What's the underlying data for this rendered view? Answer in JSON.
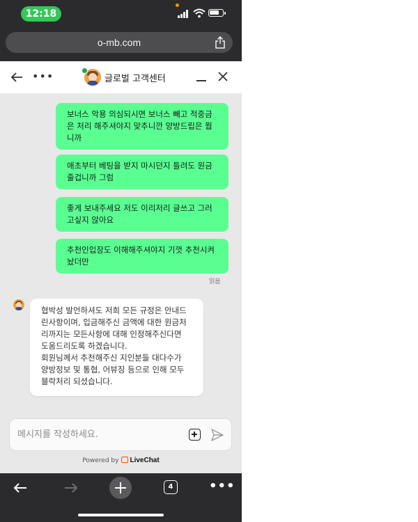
{
  "status_bar": {
    "time": "12:18"
  },
  "browser": {
    "url": "o-mb.com"
  },
  "chat": {
    "title": "글로벌 고객센터",
    "outgoing": [
      [
        "보너스 악용 의심되시면 보너스 빼고 적중금",
        "은 처리 해주셔야지 맞추니깐 양방드립은 뭡",
        "니까"
      ],
      [
        "애초부터 베팅을 받지 마시던지 틀려도 원금",
        "줄겁니까 그럼"
      ],
      [
        "좋게 보내주세요 저도 이리저리 글쓰고 그러",
        "고싶지 않아요"
      ],
      [
        "추천인입장도 이해해주셔야지 기껏 추천시켜",
        "놨더만"
      ]
    ],
    "read_receipt": "읽음",
    "incoming": [
      "협박성 발언하셔도 저희 모든 규정은 안내드",
      "린사항이며, 입금해주신 금액에 대한 원금처",
      "리까지는 모든사항에 대해 인정해주신다면",
      "도움드리도록 하겠습니다.",
      "회원님께서 추천해주신 지인분들 대다수가",
      "양방정보 및 통협, 어뷰징 등으로 인해 모두",
      "블락처리 되셨습니다."
    ],
    "input_placeholder": "메시지를 작성하세요.",
    "powered_by": "Powered by",
    "brand": "LiveChat"
  },
  "toolbar": {
    "tab_count": "4"
  },
  "colors": {
    "outgoing_bubble": "#5aff92",
    "status_time_pill": "#34c759",
    "brand_orange": "#ff5100"
  }
}
